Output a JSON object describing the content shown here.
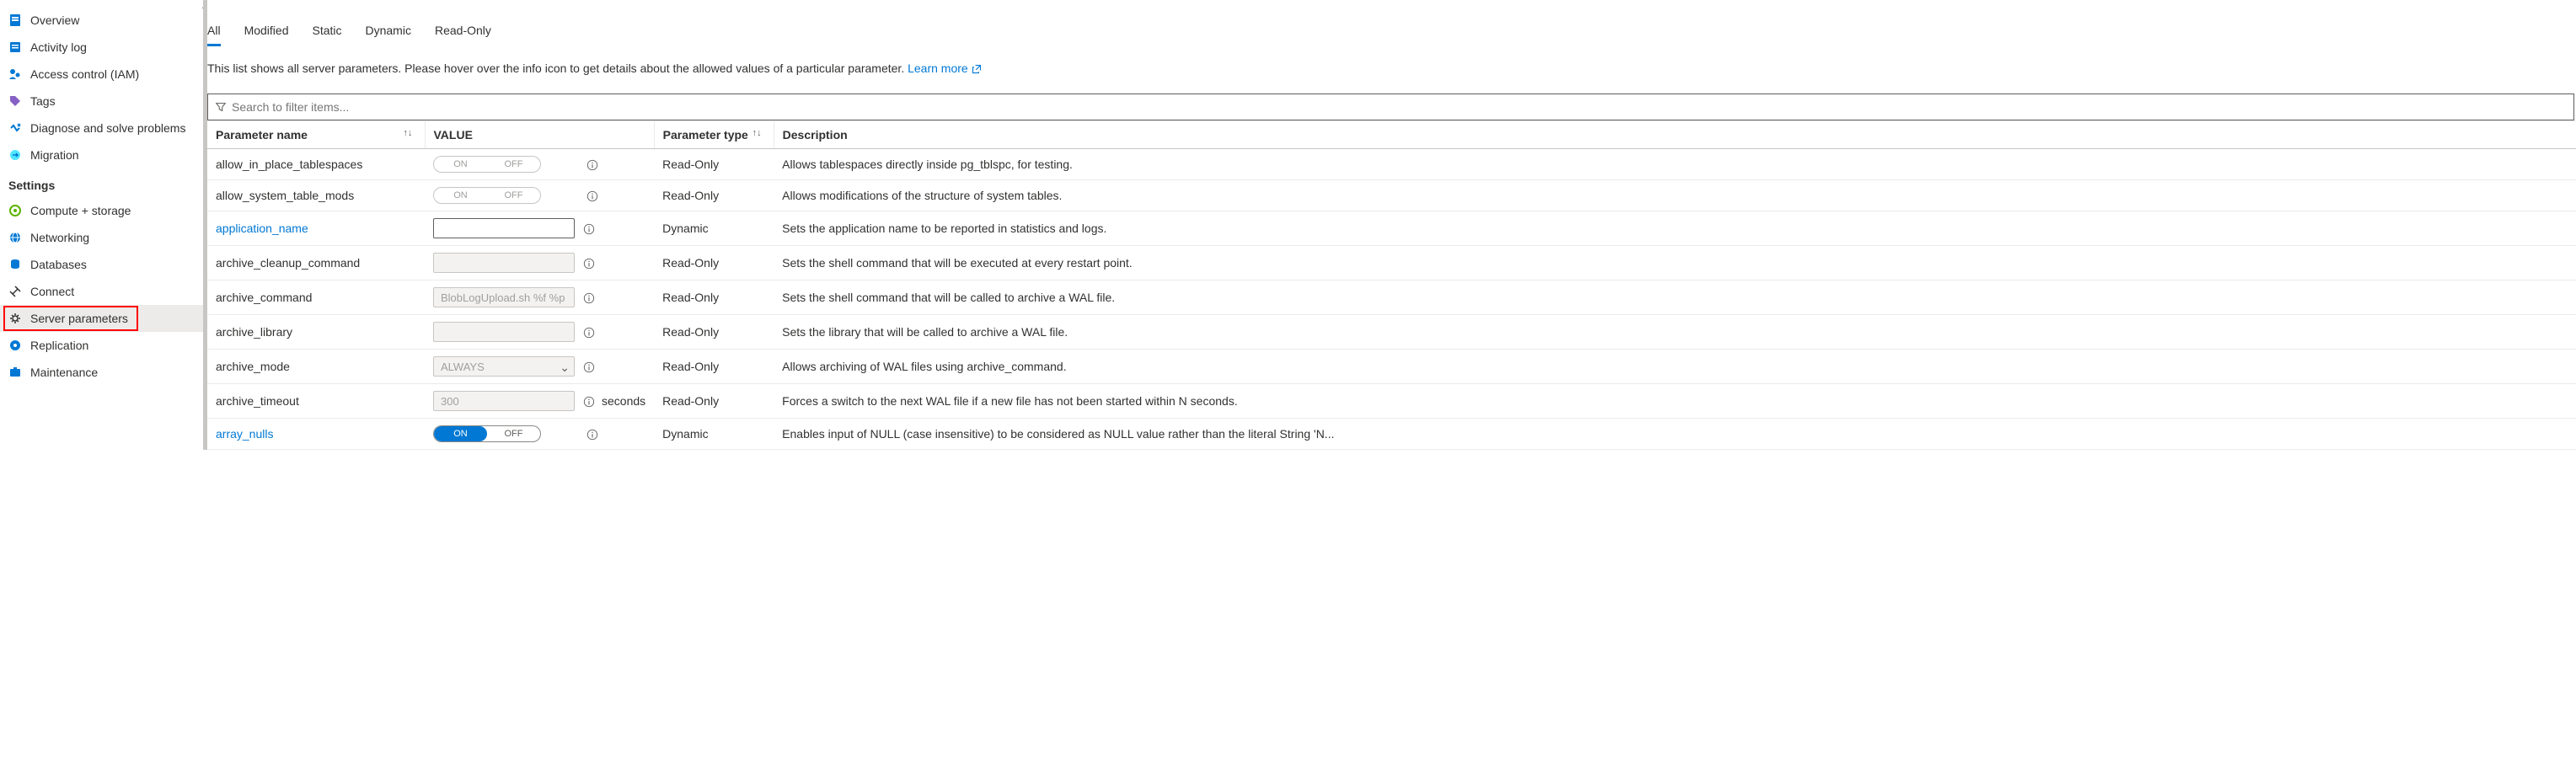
{
  "sidebar": {
    "items": [
      {
        "label": "Overview"
      },
      {
        "label": "Activity log"
      },
      {
        "label": "Access control (IAM)"
      },
      {
        "label": "Tags"
      },
      {
        "label": "Diagnose and solve problems"
      },
      {
        "label": "Migration"
      }
    ],
    "section": "Settings",
    "settings_items": [
      {
        "label": "Compute + storage"
      },
      {
        "label": "Networking"
      },
      {
        "label": "Databases"
      },
      {
        "label": "Connect"
      },
      {
        "label": "Server parameters"
      },
      {
        "label": "Replication"
      },
      {
        "label": "Maintenance"
      }
    ]
  },
  "tabs": [
    "All",
    "Modified",
    "Static",
    "Dynamic",
    "Read-Only"
  ],
  "intro_text": "This list shows all server parameters. Please hover over the info icon to get details about the allowed values of a particular parameter. ",
  "learn_more": "Learn more",
  "search_placeholder": "Search to filter items...",
  "columns": {
    "name": "Parameter name",
    "value": "VALUE",
    "type": "Parameter type",
    "desc": "Description"
  },
  "toggle_labels": {
    "on": "ON",
    "off": "OFF"
  },
  "rows": [
    {
      "name": "allow_in_place_tablespaces",
      "value_type": "toggle_disabled_off",
      "type": "Read-Only",
      "desc": "Allows tablespaces directly inside pg_tblspc, for testing."
    },
    {
      "name": "allow_system_table_mods",
      "value_type": "toggle_disabled_off",
      "type": "Read-Only",
      "desc": "Allows modifications of the structure of system tables."
    },
    {
      "name": "application_name",
      "value_type": "text",
      "value": "",
      "link": true,
      "type": "Dynamic",
      "desc": "Sets the application name to be reported in statistics and logs."
    },
    {
      "name": "archive_cleanup_command",
      "value_type": "text_disabled",
      "value": "",
      "type": "Read-Only",
      "desc": "Sets the shell command that will be executed at every restart point."
    },
    {
      "name": "archive_command",
      "value_type": "text_disabled",
      "value": "BlobLogUpload.sh %f %p",
      "type": "Read-Only",
      "desc": "Sets the shell command that will be called to archive a WAL file."
    },
    {
      "name": "archive_library",
      "value_type": "text_disabled",
      "value": "",
      "type": "Read-Only",
      "desc": "Sets the library that will be called to archive a WAL file."
    },
    {
      "name": "archive_mode",
      "value_type": "select_disabled",
      "value": "ALWAYS",
      "type": "Read-Only",
      "desc": "Allows archiving of WAL files using archive_command."
    },
    {
      "name": "archive_timeout",
      "value_type": "text_disabled",
      "value": "300",
      "unit": "seconds",
      "type": "Read-Only",
      "desc": "Forces a switch to the next WAL file if a new file has not been started within N seconds."
    },
    {
      "name": "array_nulls",
      "value_type": "toggle_on",
      "link": true,
      "type": "Dynamic",
      "desc": "Enables input of NULL (case insensitive) to be considered as NULL value rather than the literal String 'N..."
    }
  ]
}
